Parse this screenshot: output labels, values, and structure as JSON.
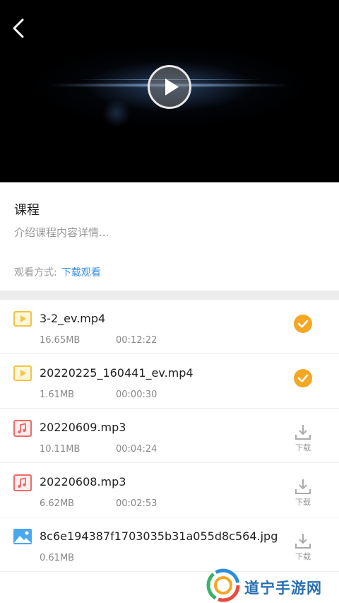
{
  "course": {
    "title": "课程",
    "description": "介绍课程内容详情...",
    "watch_label": "观看方式:",
    "watch_mode": "下载观看"
  },
  "files": [
    {
      "name": "3-2_ev.mp4",
      "size": "16.65MB",
      "duration": "00:12:22",
      "type": "video",
      "status": "downloaded"
    },
    {
      "name": "20220225_160441_ev.mp4",
      "size": "1.61MB",
      "duration": "00:00:30",
      "type": "video",
      "status": "downloaded"
    },
    {
      "name": "20220609.mp3",
      "size": "10.11MB",
      "duration": "00:04:24",
      "type": "audio",
      "status": "download",
      "action_label": "下载"
    },
    {
      "name": "20220608.mp3",
      "size": "6.62MB",
      "duration": "00:02:53",
      "type": "audio",
      "status": "download",
      "action_label": "下载"
    },
    {
      "name": "8c6e194387f1703035b31a055d8c564.jpg",
      "size": "0.61MB",
      "duration": "",
      "type": "image",
      "status": "download",
      "action_label": "下载"
    }
  ],
  "watermark": {
    "text": "道宁手游网"
  },
  "icons": {
    "back": "back-arrow-icon",
    "play": "play-icon",
    "video": "video-file-icon",
    "audio": "music-file-icon",
    "image": "image-file-icon",
    "done": "check-circle-icon",
    "download": "download-icon"
  },
  "colors": {
    "accent_blue": "#3a8ee6",
    "check_orange": "#f5a623",
    "video_yellow": "#f5c342",
    "audio_red": "#f06a6a",
    "image_blue": "#4aa8f0"
  }
}
